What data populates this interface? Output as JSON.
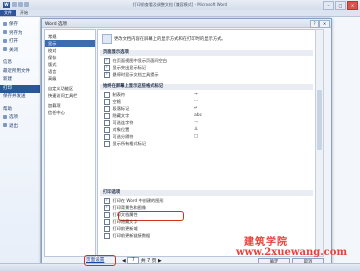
{
  "window": {
    "title": "打印前查看及调整文档 [兼容模式] - Microsoft Word",
    "buttons": {
      "minimize": "–",
      "maximize": "□",
      "close": "✕"
    }
  },
  "ribbon": {
    "file_tab": "文件",
    "start_tab": "开始"
  },
  "backstage": {
    "items": [
      {
        "label": "保存",
        "selected": false
      },
      {
        "label": "另存为",
        "selected": false
      },
      {
        "label": "打开",
        "selected": false
      },
      {
        "label": "关闭",
        "selected": false
      },
      {
        "label": "信息",
        "selected": false
      },
      {
        "label": "最近所用文件",
        "selected": false
      },
      {
        "label": "新建",
        "selected": false
      },
      {
        "label": "打印",
        "selected": true
      },
      {
        "label": "保存并发送",
        "selected": false
      },
      {
        "label": "帮助",
        "selected": false
      },
      {
        "label": "选项",
        "selected": false
      },
      {
        "label": "退出",
        "selected": false
      }
    ]
  },
  "dialog": {
    "title": "Word 选项",
    "help": "?",
    "close": "✕",
    "nav": [
      "常规",
      "显示",
      "校对",
      "保存",
      "版式",
      "语言",
      "高级",
      "自定义功能区",
      "快速访问工具栏",
      "加载项",
      "信任中心"
    ],
    "nav_selected": "显示",
    "intro": "更改文档内容在屏幕上的显示方式和在打印时的显示方式。",
    "section1": {
      "title": "页面显示选项",
      "options": [
        {
          "label": "在页面视图中显示页面间空白",
          "checked": true
        },
        {
          "label": "显示突出显示标记",
          "checked": true
        },
        {
          "label": "悬停时显示文档工具提示",
          "checked": true
        }
      ]
    },
    "section2": {
      "title": "始终在屏幕上显示这些格式标记",
      "options": [
        {
          "label": "制表符",
          "sym": "→",
          "checked": false
        },
        {
          "label": "空格",
          "sym": "···",
          "checked": false
        },
        {
          "label": "段落标记",
          "sym": "↵",
          "checked": false
        },
        {
          "label": "隐藏文字",
          "sym": "abc",
          "checked": false
        },
        {
          "label": "可选连字符",
          "sym": "¬",
          "checked": false
        },
        {
          "label": "对象位置",
          "sym": "⚓",
          "checked": false
        },
        {
          "label": "可选分隔符",
          "sym": "□",
          "checked": false
        },
        {
          "label": "显示所有格式标记",
          "sym": "",
          "checked": false
        }
      ]
    },
    "section3": {
      "title": "打印选项",
      "options": [
        {
          "label": "打印在 Word 中创建的图形",
          "checked": true
        },
        {
          "label": "打印背景色和图像",
          "checked": true
        },
        {
          "label": "打印文档属性",
          "checked": false
        },
        {
          "label": "打印隐藏文字",
          "checked": false
        },
        {
          "label": "打印前更新域",
          "checked": false
        },
        {
          "label": "打印前更新链接数据",
          "checked": false
        }
      ]
    },
    "ok": "确定",
    "cancel": "取消"
  },
  "status": {
    "print_settings": "页面设置",
    "page_prefix": "◀",
    "page_current": "7",
    "page_of": "共 7 页",
    "page_next": "▶"
  },
  "watermark": {
    "cn": "建筑学院",
    "url": "www.2xuewang.com"
  }
}
